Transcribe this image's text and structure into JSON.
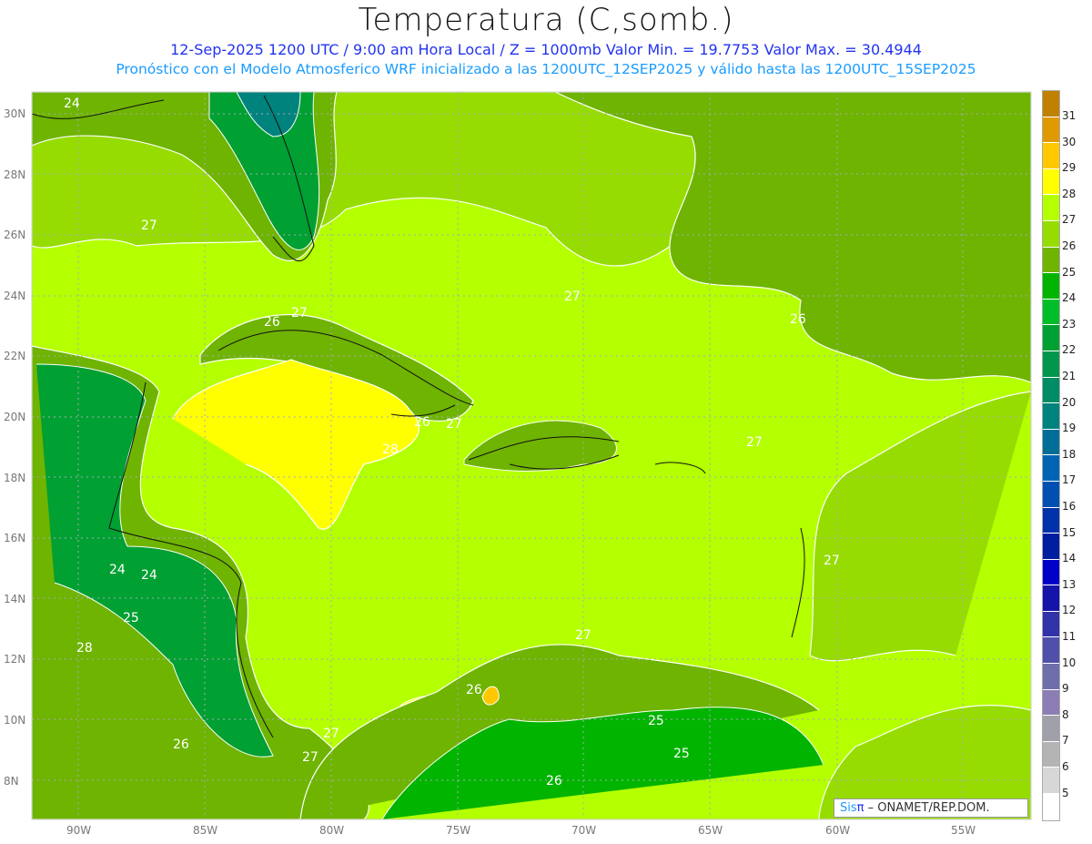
{
  "title": "Temperatura (C,somb.)",
  "subtitle1": "12-Sep-2025  1200 UTC / 9:00 am Hora Local / Z = 1000mb   Valor Min. = 19.7753  Valor Max. = 30.4944",
  "subtitle2": "Pronóstico con el Modelo Atmosferico WRF inicializado a las 1200UTC_12SEP2025 y válido hasta las  1200UTC_15SEP2025",
  "lon_ticks": [
    "90W",
    "85W",
    "80W",
    "75W",
    "70W",
    "65W",
    "60W",
    "55W"
  ],
  "lat_ticks": [
    "30N",
    "28N",
    "26N",
    "24N",
    "22N",
    "20N",
    "18N",
    "16N",
    "14N",
    "12N",
    "10N",
    "8N"
  ],
  "colorbar": {
    "labels": [
      "31",
      "30",
      "29",
      "28",
      "27",
      "26",
      "25",
      "24",
      "23",
      "22",
      "21",
      "20",
      "19",
      "18",
      "17",
      "16",
      "15",
      "14",
      "13",
      "12",
      "11",
      "10",
      "9",
      "8",
      "7",
      "6",
      "5"
    ],
    "colors": [
      "#c08000",
      "#e09a00",
      "#ffc800",
      "#ffff00",
      "#b4ff00",
      "#96dc00",
      "#6eb400",
      "#00b400",
      "#00be28",
      "#00a032",
      "#00964b",
      "#008c64",
      "#00827d",
      "#006e96",
      "#0064b4",
      "#0050b4",
      "#0032aa",
      "#001ea0",
      "#0000c8",
      "#1414aa",
      "#3232aa",
      "#5050aa",
      "#6e6eaa",
      "#8c7db4",
      "#a0a0aa",
      "#b4b4b4",
      "#d7d7d7",
      "#ffffff"
    ]
  },
  "contour_labels": [
    "24",
    "27",
    "26",
    "27",
    "27",
    "26",
    "26",
    "27",
    "28",
    "27",
    "27",
    "24",
    "24",
    "25",
    "28",
    "26",
    "27",
    "26",
    "25",
    "27",
    "26",
    "27",
    "25"
  ],
  "credit": {
    "sis": "Sis",
    "pi": "π",
    "rest": "– ONAMET/REP.DOM."
  }
}
